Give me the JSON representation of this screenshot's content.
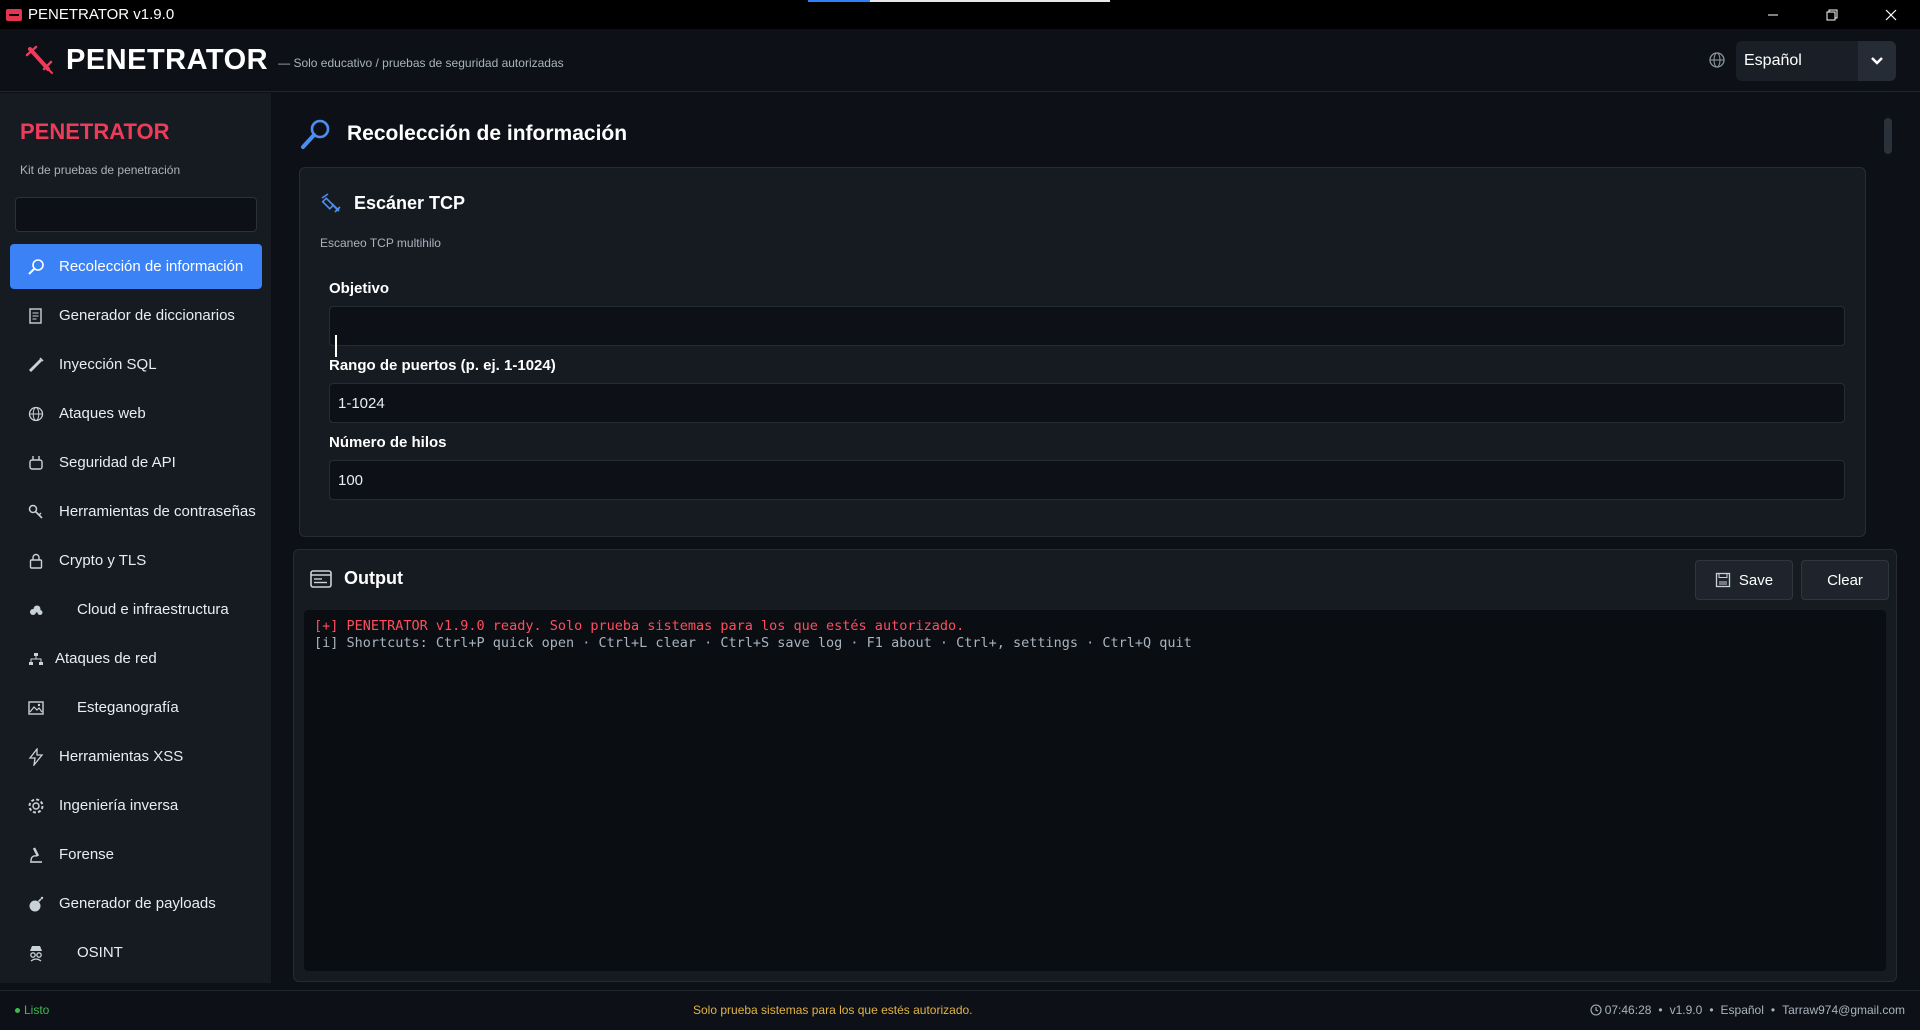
{
  "window": {
    "title": "PENETRATOR v1.9.0",
    "controls": [
      "minimize",
      "restore",
      "close"
    ]
  },
  "header": {
    "brand": "PENETRATOR",
    "tagline": "— Solo educativo / pruebas de seguridad autorizadas",
    "language": "Español"
  },
  "sidebar": {
    "title": "PENETRATOR",
    "subtitle": "Kit de pruebas de penetración",
    "search_value": "",
    "items": [
      {
        "label": "Recolección de información",
        "icon": "magnifier-icon",
        "active": true
      },
      {
        "label": "Generador de diccionarios",
        "icon": "notepad-icon"
      },
      {
        "label": "Inyección SQL",
        "icon": "syringe-icon"
      },
      {
        "label": "Ataques web",
        "icon": "globe-icon"
      },
      {
        "label": "Seguridad de API",
        "icon": "plug-icon"
      },
      {
        "label": "Herramientas de contraseñas",
        "icon": "key-icon"
      },
      {
        "label": "Crypto y TLS",
        "icon": "lock-icon"
      },
      {
        "label": "Cloud e infraestructura",
        "icon": "cloud-icon"
      },
      {
        "label": "Ataques de red",
        "icon": "network-icon"
      },
      {
        "label": "Esteganografía",
        "icon": "image-icon"
      },
      {
        "label": "Herramientas XSS",
        "icon": "lightning-icon"
      },
      {
        "label": "Ingeniería inversa",
        "icon": "gear-icon"
      },
      {
        "label": "Forense",
        "icon": "microscope-icon"
      },
      {
        "label": "Generador de payloads",
        "icon": "bomb-icon"
      },
      {
        "label": "OSINT",
        "icon": "spy-icon"
      }
    ]
  },
  "main": {
    "section_title": "Recolección de información",
    "card": {
      "title": "Escáner TCP",
      "description": "Escaneo TCP multihilo",
      "fields": [
        {
          "label": "Objetivo",
          "value": ""
        },
        {
          "label": "Rango de puertos (p. ej. 1-1024)",
          "value": "1-1024"
        },
        {
          "label": "Número de hilos",
          "value": "100"
        }
      ]
    }
  },
  "output": {
    "title": "Output",
    "save_label": "Save",
    "clear_label": "Clear",
    "lines": [
      "[+] PENETRATOR v1.9.0 ready. Solo prueba sistemas para los que estés autorizado.",
      "[i] Shortcuts: Ctrl+P quick open · Ctrl+L clear · Ctrl+S save log · F1 about · Ctrl+, settings · Ctrl+Q quit"
    ]
  },
  "status": {
    "state": "Listo",
    "warning": "Solo prueba sistemas para los que estés autorizado.",
    "time": "07:46:28",
    "version": "v1.9.0",
    "language": "Español",
    "email": "Tarraw974@gmail.com"
  },
  "colors": {
    "accent": "#3b82f6",
    "brand_red": "#ef3b5a",
    "warning": "#e3b341",
    "ok": "#3fb950"
  }
}
